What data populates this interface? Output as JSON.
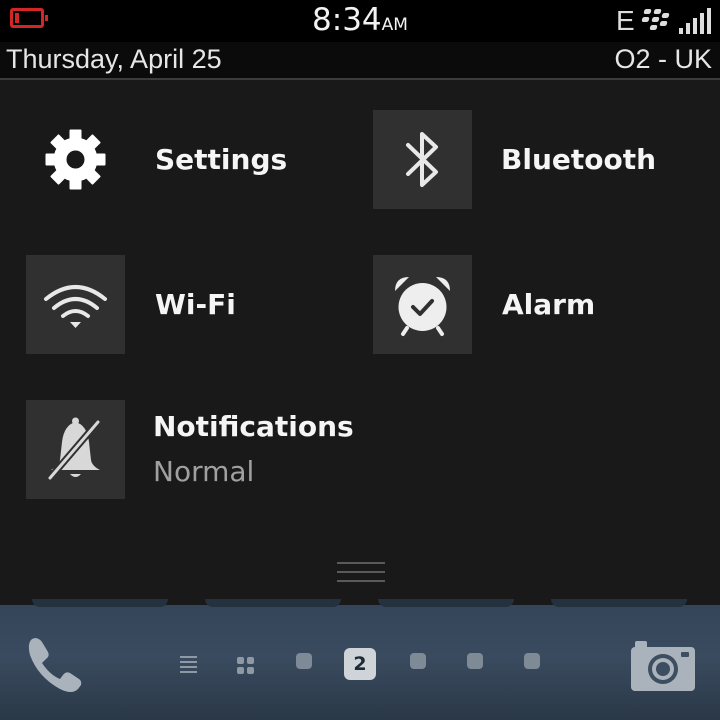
{
  "status_bar": {
    "time": "8:34",
    "ampm": "AM",
    "network_type": "E",
    "battery_level": 0.15,
    "battery_color": "#d32626",
    "signal_bars": 5,
    "icons": [
      "battery-icon",
      "blackberry-logo-icon",
      "signal-icon"
    ]
  },
  "date_bar": {
    "date": "Thursday, April 25",
    "carrier": "O2 - UK"
  },
  "quick_settings": {
    "settings": {
      "label": "Settings",
      "icon": "gear-icon"
    },
    "bluetooth": {
      "label": "Bluetooth",
      "icon": "bluetooth-icon"
    },
    "wifi": {
      "label": "Wi-Fi",
      "icon": "wifi-icon"
    },
    "alarm": {
      "label": "Alarm",
      "icon": "alarm-clock-icon"
    },
    "notifications": {
      "label": "Notifications",
      "value": "Normal",
      "icon": "bell-muted-icon"
    }
  },
  "dock": {
    "active_page": "2",
    "icons": [
      "phone-icon",
      "list-icon",
      "grid-icon",
      "camera-icon"
    ]
  }
}
